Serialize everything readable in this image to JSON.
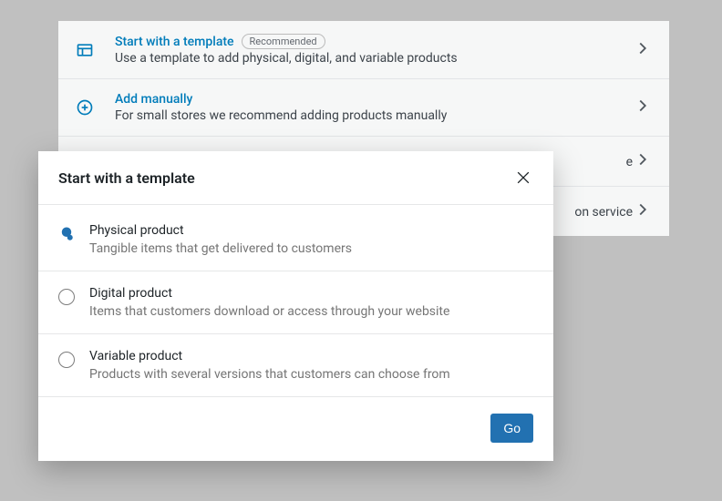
{
  "background_options": [
    {
      "title": "Start with a template",
      "badge": "Recommended",
      "description": "Use a template to add physical, digital, and variable products",
      "icon": "template"
    },
    {
      "title": "Add manually",
      "badge": null,
      "description": "For small stores we recommend adding products manually",
      "icon": "plus-circle"
    },
    {
      "title": "",
      "badge": null,
      "description": "e",
      "icon": ""
    },
    {
      "title": "",
      "badge": null,
      "description": "on service",
      "icon": ""
    }
  ],
  "modal": {
    "title": "Start with a template",
    "options": [
      {
        "title": "Physical product",
        "description": "Tangible items that get delivered to customers",
        "selected": true
      },
      {
        "title": "Digital product",
        "description": "Items that customers download or access through your website",
        "selected": false
      },
      {
        "title": "Variable product",
        "description": "Products with several versions that customers can choose from",
        "selected": false
      }
    ],
    "go_label": "Go"
  }
}
